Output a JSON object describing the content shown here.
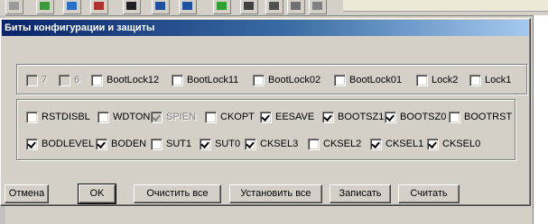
{
  "dialog": {
    "title": "Биты конфигурации и защиты"
  },
  "lock_bits": [
    {
      "label": "7",
      "checked": false,
      "disabled": true
    },
    {
      "label": "6",
      "checked": false,
      "disabled": true
    },
    {
      "label": "BootLock12",
      "checked": false,
      "disabled": false
    },
    {
      "label": "BootLock11",
      "checked": false,
      "disabled": false
    },
    {
      "label": "BootLock02",
      "checked": false,
      "disabled": false
    },
    {
      "label": "BootLock01",
      "checked": false,
      "disabled": false
    },
    {
      "label": "Lock2",
      "checked": false,
      "disabled": false
    },
    {
      "label": "Lock1",
      "checked": false,
      "disabled": false
    }
  ],
  "fuse_row1": [
    {
      "label": "RSTDISBL",
      "checked": false,
      "disabled": false
    },
    {
      "label": "WDTON",
      "checked": false,
      "disabled": false
    },
    {
      "label": "SPIEN",
      "checked": true,
      "disabled": true
    },
    {
      "label": "CKOPT",
      "checked": false,
      "disabled": false
    },
    {
      "label": "EESAVE",
      "checked": true,
      "disabled": false
    },
    {
      "label": "BOOTSZ1",
      "checked": true,
      "disabled": false
    },
    {
      "label": "BOOTSZ0",
      "checked": true,
      "disabled": false
    },
    {
      "label": "BOOTRST",
      "checked": false,
      "disabled": false
    }
  ],
  "fuse_row2": [
    {
      "label": "BODLEVEL",
      "checked": true,
      "disabled": false
    },
    {
      "label": "BODEN",
      "checked": true,
      "disabled": false
    },
    {
      "label": "SUT1",
      "checked": false,
      "disabled": false
    },
    {
      "label": "SUT0",
      "checked": true,
      "disabled": false
    },
    {
      "label": "CKSEL3",
      "checked": true,
      "disabled": false
    },
    {
      "label": "CKSEL2",
      "checked": false,
      "disabled": false
    },
    {
      "label": "CKSEL1",
      "checked": true,
      "disabled": false
    },
    {
      "label": "CKSEL0",
      "checked": true,
      "disabled": false
    }
  ],
  "buttons": {
    "cancel": "Отмена",
    "ok": "OK",
    "clear_all": "Очистить все",
    "set_all": "Установить все",
    "write": "Записать",
    "read": "Считать"
  }
}
